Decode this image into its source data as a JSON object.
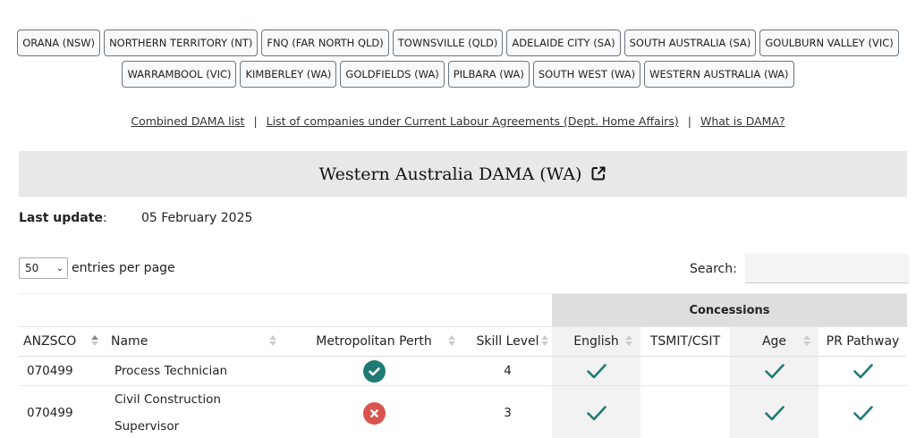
{
  "regions": {
    "row1": [
      "ORANA (NSW)",
      "NORTHERN TERRITORY (NT)",
      "FNQ (FAR NORTH QLD)",
      "TOWNSVILLE (QLD)",
      "ADELAIDE CITY (SA)",
      "SOUTH AUSTRALIA (SA)",
      "GOULBURN VALLEY (VIC)"
    ],
    "row2": [
      "WARRAMBOOL (VIC)",
      "KIMBERLEY (WA)",
      "GOLDFIELDS (WA)",
      "PILBARA (WA)",
      "SOUTH WEST (WA)",
      "WESTERN AUSTRALIA (WA)"
    ]
  },
  "links": {
    "combined": "Combined DAMA list",
    "companies": "List of companies under Current Labour Agreements (Dept. Home Affairs)",
    "what": "What is DAMA?",
    "separator": "|"
  },
  "title": "Western Australia DAMA (WA)",
  "last_update": {
    "label": "Last update",
    "colon": ":",
    "value": "05 February 2025"
  },
  "entries": {
    "selected": "50",
    "label": "entries per page"
  },
  "search": {
    "label": "Search:",
    "value": ""
  },
  "table": {
    "group_header": "Concessions",
    "columns": [
      "ANZSCO",
      "Name",
      "Metropolitan Perth",
      "Skill Level",
      "English",
      "TSMIT/CSIT",
      "Age",
      "PR Pathway"
    ],
    "rows": [
      {
        "anzsco": "070499",
        "name": "Process Technician",
        "metro": "yes",
        "skill": "4",
        "english": true,
        "tsmit": false,
        "age": true,
        "pr": true
      },
      {
        "anzsco": "070499",
        "name": "Civil Construction Supervisor",
        "metro": "no",
        "skill": "3",
        "english": true,
        "tsmit": false,
        "age": true,
        "pr": true
      }
    ]
  },
  "colors": {
    "teal": "#1f7a73",
    "red": "#d9534f"
  },
  "icons": {
    "external": "external-link-icon",
    "yes": "check-circle-icon",
    "no": "x-circle-icon",
    "check": "check-icon"
  }
}
